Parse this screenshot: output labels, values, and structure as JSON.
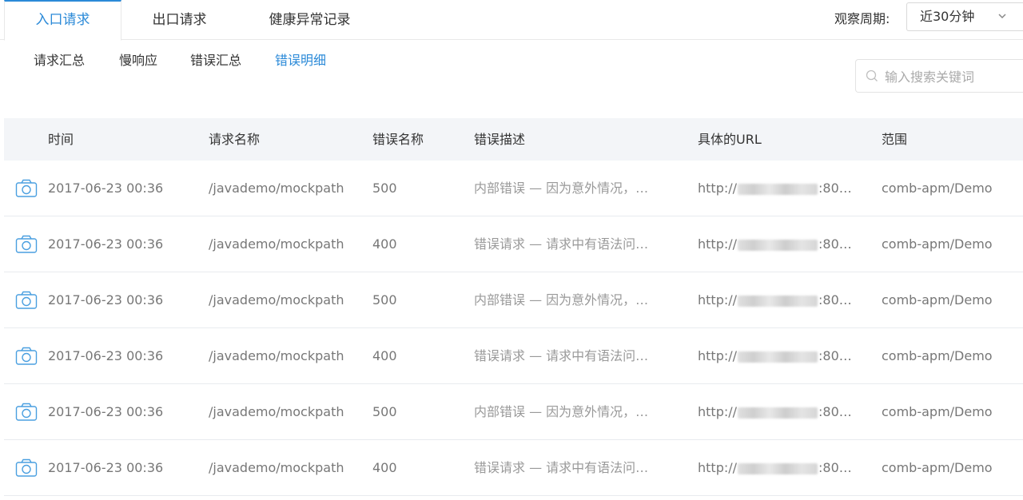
{
  "top_tabs": [
    {
      "label": "入口请求",
      "active": true
    },
    {
      "label": "出口请求",
      "active": false
    },
    {
      "label": "健康异常记录",
      "active": false
    }
  ],
  "period": {
    "label": "观察周期:",
    "value": "近30分钟"
  },
  "sub_tabs": [
    {
      "label": "请求汇总",
      "active": false
    },
    {
      "label": "慢响应",
      "active": false
    },
    {
      "label": "错误汇总",
      "active": false
    },
    {
      "label": "错误明细",
      "active": true
    }
  ],
  "search": {
    "placeholder": "输入搜索关键词"
  },
  "table": {
    "headers": [
      "时间",
      "请求名称",
      "错误名称",
      "错误描述",
      "具体的URL",
      "范围"
    ],
    "rows": [
      {
        "time": "2017-06-23 00:36",
        "name": "/javademo/mockpath",
        "code": "500",
        "desc": "内部错误 — 因为意外情况，…",
        "url_prefix": "http://",
        "url_suffix": ":80…",
        "scope": "comb-apm/Demo"
      },
      {
        "time": "2017-06-23 00:36",
        "name": "/javademo/mockpath",
        "code": "400",
        "desc": "错误请求 — 请求中有语法问…",
        "url_prefix": "http://",
        "url_suffix": ":80…",
        "scope": "comb-apm/Demo"
      },
      {
        "time": "2017-06-23 00:36",
        "name": "/javademo/mockpath",
        "code": "500",
        "desc": "内部错误 — 因为意外情况，…",
        "url_prefix": "http://",
        "url_suffix": ":80…",
        "scope": "comb-apm/Demo"
      },
      {
        "time": "2017-06-23 00:36",
        "name": "/javademo/mockpath",
        "code": "400",
        "desc": "错误请求 — 请求中有语法问…",
        "url_prefix": "http://",
        "url_suffix": ":80…",
        "scope": "comb-apm/Demo"
      },
      {
        "time": "2017-06-23 00:36",
        "name": "/javademo/mockpath",
        "code": "500",
        "desc": "内部错误 — 因为意外情况，…",
        "url_prefix": "http://",
        "url_suffix": ":80…",
        "scope": "comb-apm/Demo"
      },
      {
        "time": "2017-06-23 00:36",
        "name": "/javademo/mockpath",
        "code": "400",
        "desc": "错误请求 — 请求中有语法问…",
        "url_prefix": "http://",
        "url_suffix": ":80…",
        "scope": "comb-apm/Demo"
      }
    ]
  },
  "colors": {
    "accent": "#2b8ad8",
    "header_bg": "#f3f5f8",
    "muted_text": "#777777"
  },
  "icons": {
    "row_action": "camera-icon",
    "search": "search-icon",
    "select": "chevron-down-icon"
  }
}
